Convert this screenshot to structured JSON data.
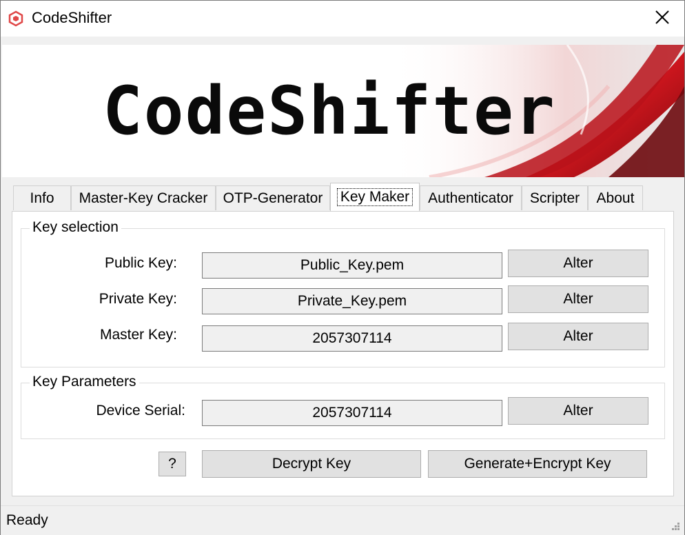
{
  "window": {
    "title": "CodeShifter",
    "icons": {
      "app": "codeshifter-logo-icon",
      "close": "close-icon"
    }
  },
  "banner": {
    "logo_text": "CodeShifter",
    "accent_color": "#c0141c"
  },
  "tabs": [
    {
      "label": "Info",
      "active": false
    },
    {
      "label": "Master-Key Cracker",
      "active": false
    },
    {
      "label": "OTP-Generator",
      "active": false
    },
    {
      "label": "Key Maker",
      "active": true
    },
    {
      "label": "Authenticator",
      "active": false
    },
    {
      "label": "Scripter",
      "active": false
    },
    {
      "label": "About",
      "active": false
    }
  ],
  "key_selection": {
    "legend": "Key selection",
    "rows": [
      {
        "label": "Public Key:",
        "value": "Public_Key.pem",
        "button": "Alter"
      },
      {
        "label": "Private Key:",
        "value": "Private_Key.pem",
        "button": "Alter"
      },
      {
        "label": "Master Key:",
        "value": "2057307114",
        "button": "Alter"
      }
    ]
  },
  "key_parameters": {
    "legend": "Key Parameters",
    "rows": [
      {
        "label": "Device Serial:",
        "value": "2057307114",
        "button": "Alter"
      }
    ]
  },
  "actions": {
    "help": "?",
    "decrypt": "Decrypt Key",
    "generate": "Generate+Encrypt Key"
  },
  "status": {
    "text": "Ready",
    "grip_icon": "resize-grip-icon"
  }
}
